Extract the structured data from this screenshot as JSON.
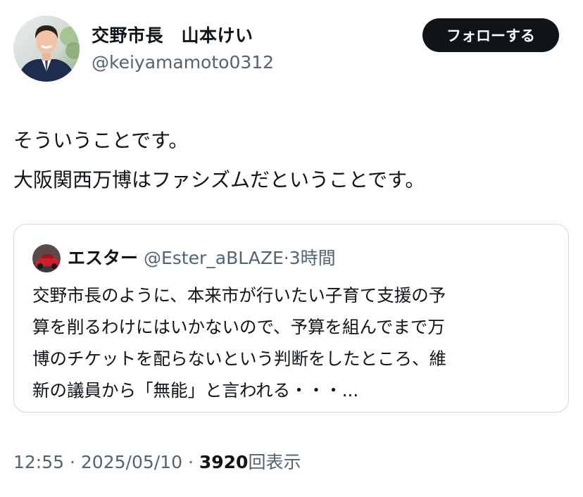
{
  "author": {
    "display_name": "交野市長　山本けい",
    "handle": "@keiyamamoto0312",
    "follow_label": "フォローする"
  },
  "tweet": {
    "lines": [
      "そういうことです。",
      "大阪関西万博はファシズムだということです。"
    ]
  },
  "quote": {
    "name": "エスター",
    "handle": "@Ester_aBLAZE",
    "separator": "·",
    "time": "3時間",
    "lines": [
      "交野市長のように、本来市が行いたい子育て支援の予",
      "算を削るわけにはいかないので、予算を組んでまで万",
      "博のチケットを配らないという判断をしたところ、維",
      "新の議員から「無能」と言われる・・・..."
    ]
  },
  "meta": {
    "time": "12:55",
    "separator": "·",
    "date": "2025/05/10",
    "views_count": "3920",
    "views_label": "回表示"
  },
  "colors": {
    "text_primary": "#0f1419",
    "text_secondary": "#536471",
    "border": "#cfd9de",
    "button_bg": "#0f1419"
  }
}
